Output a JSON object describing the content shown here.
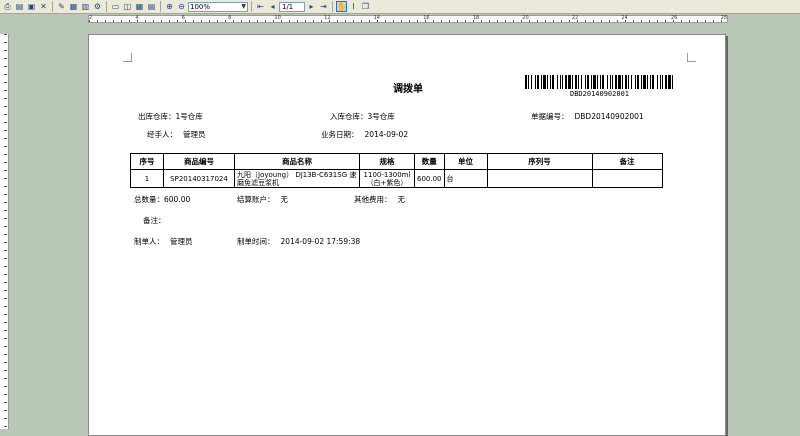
{
  "toolbar": {
    "zoom": "100%",
    "page": "1/1"
  },
  "ruler": {
    "marks": [
      "2",
      "4",
      "6",
      "8",
      "10",
      "12",
      "14",
      "16",
      "18",
      "20",
      "22",
      "24",
      "26",
      "28"
    ]
  },
  "doc": {
    "title": "调拨单",
    "barcode": "DBD20140902001",
    "from_label": "出库仓库：",
    "from_value": "1号仓库",
    "to_label": "入库仓库：",
    "to_value": "3号仓库",
    "no_label": "单据编号：",
    "no_value": "DBD20140902001",
    "handler_label": "经手人：",
    "handler_value": "管理员",
    "date_label": "业务日期：",
    "date_value": "2014-09-02",
    "table": {
      "headers": [
        "序号",
        "商品编号",
        "商品名称",
        "规格",
        "数量",
        "单位",
        "序列号",
        "备注"
      ],
      "rows": [
        [
          "1",
          "SP20140317024",
          "九阳（Joyoung） DJ13B-C631SG 速磨免滤豆浆机",
          "1100-1300ml（白+紫色）",
          "600.00",
          "台",
          "",
          ""
        ]
      ]
    },
    "total_label": "总数量：",
    "total_value": "600.00",
    "account_label": "结算账户：",
    "account_value": "无",
    "other_label": "其他费用：",
    "other_value": "无",
    "remark_label": "备注：",
    "maker_label": "制单人：",
    "maker_value": "管理员",
    "time_label": "制单时间：",
    "time_value": "2014-09-02 17:59:38"
  }
}
